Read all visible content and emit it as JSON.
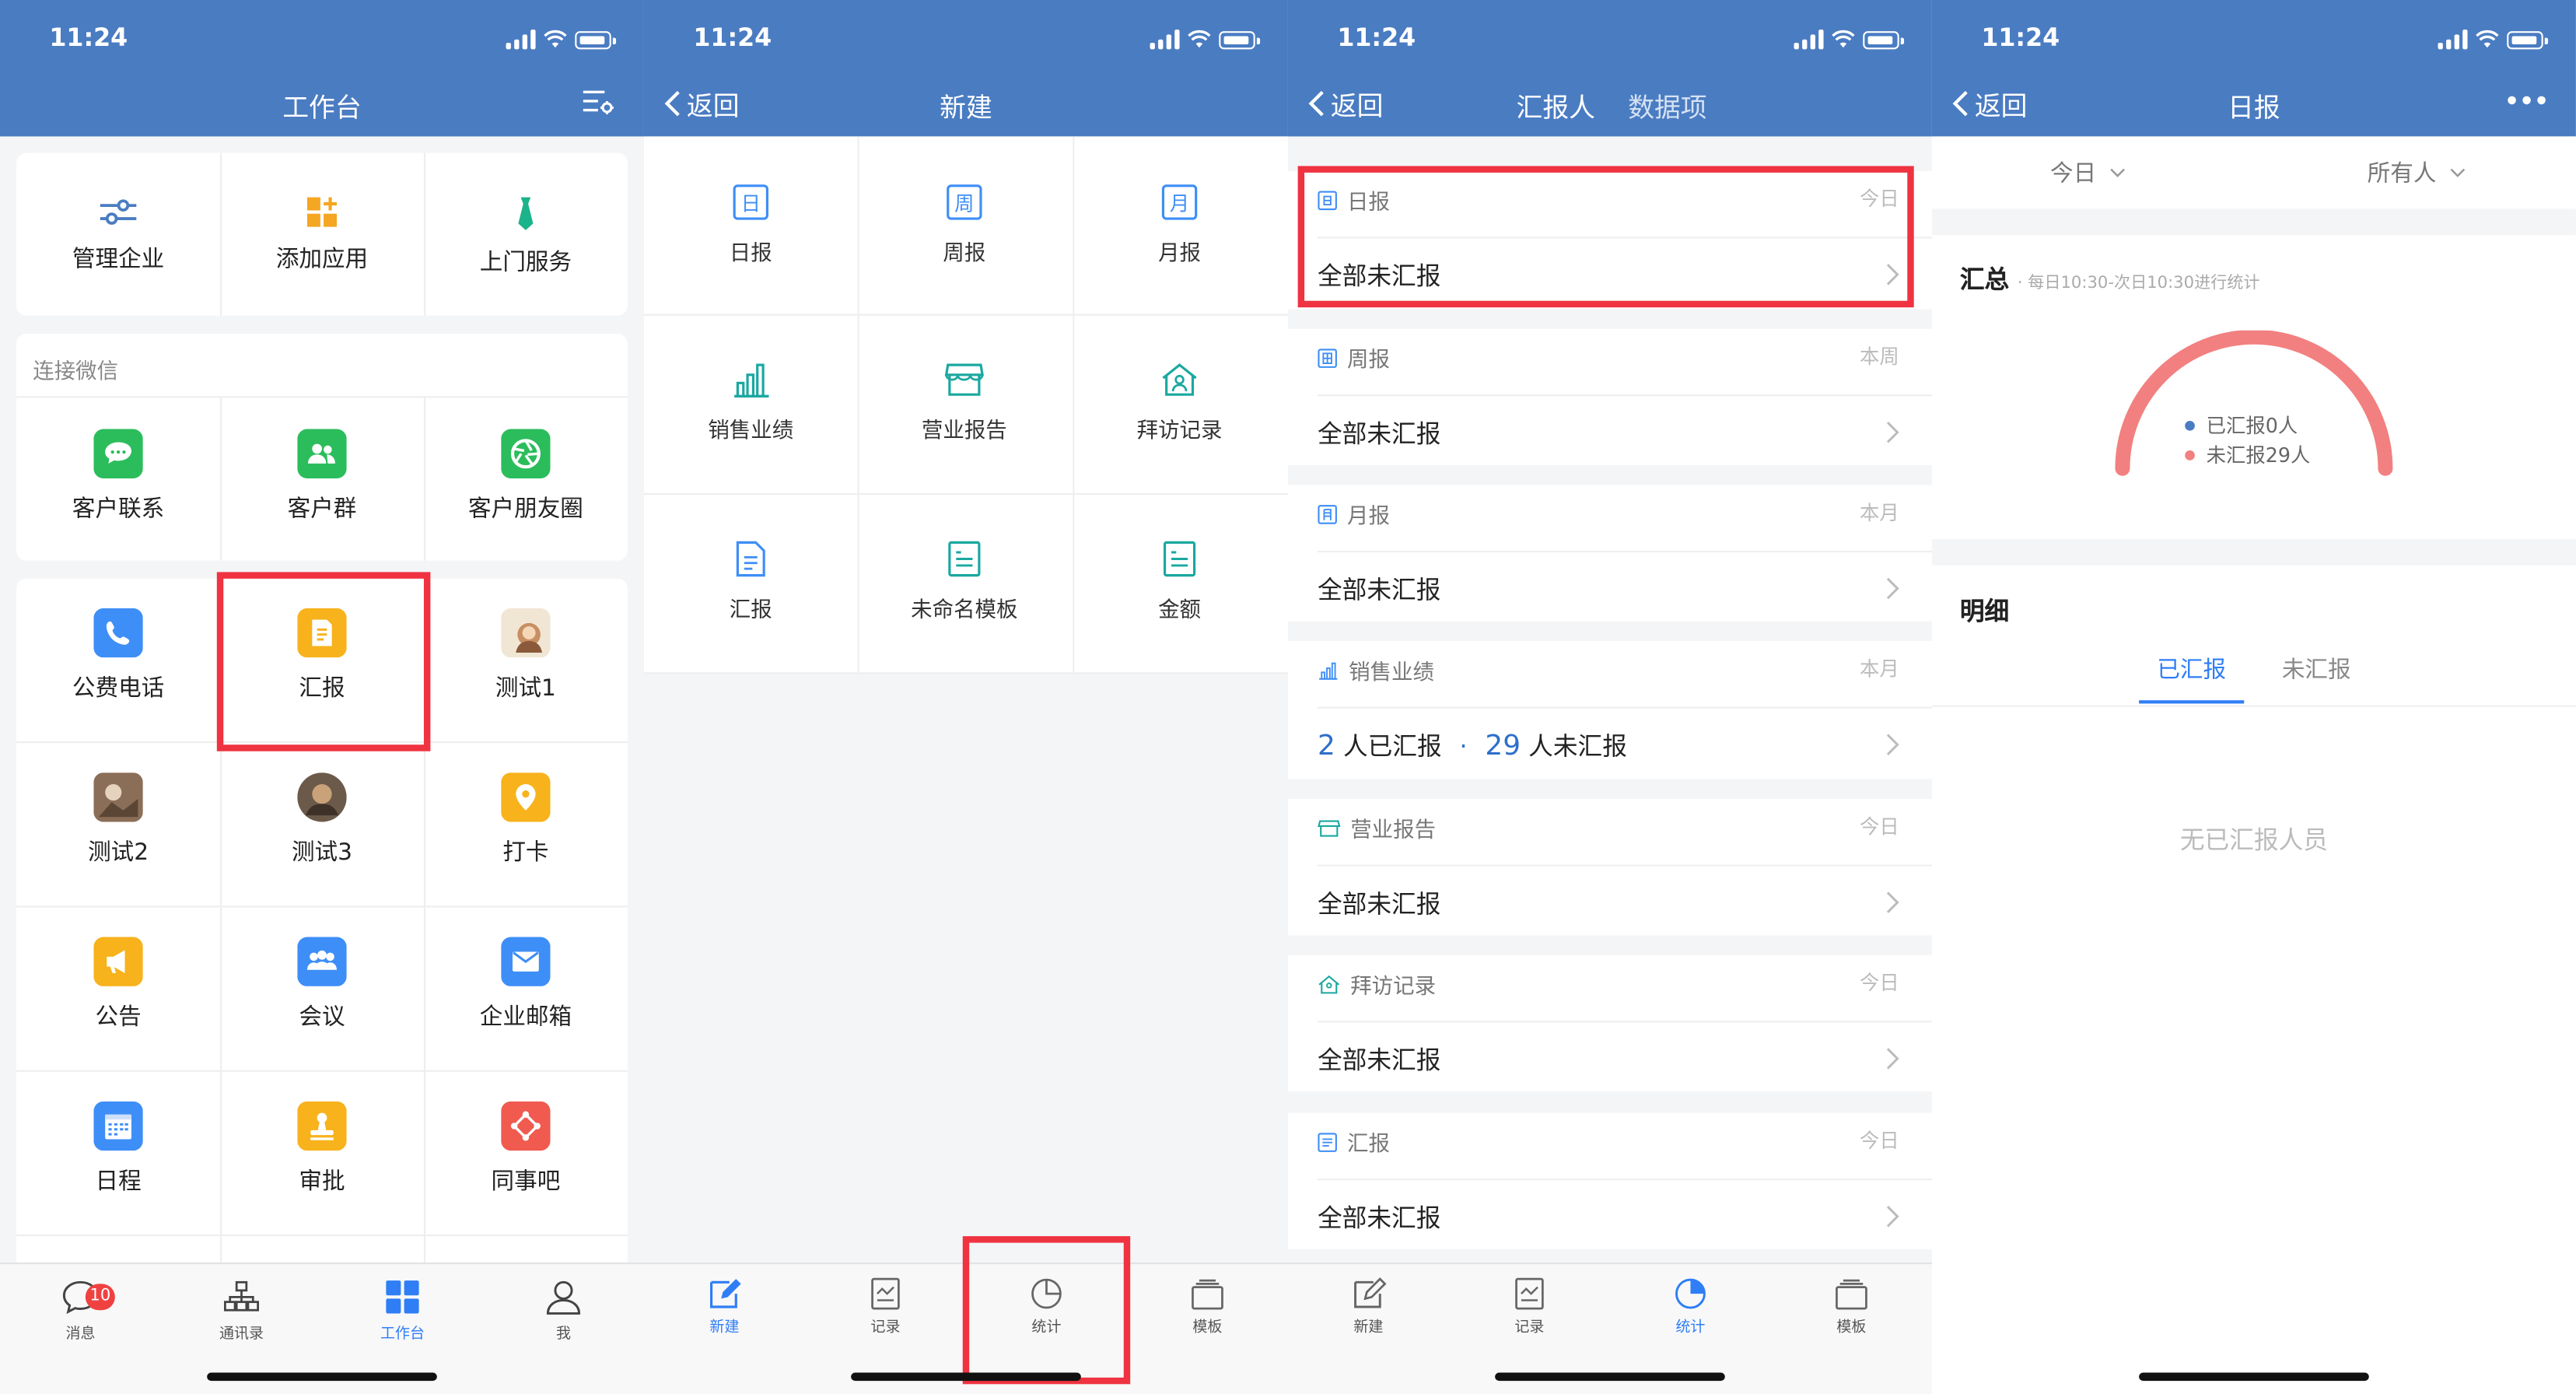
{
  "status": {
    "time": "11:24"
  },
  "screen1": {
    "title": "工作台",
    "top": [
      {
        "label": "管理企业"
      },
      {
        "label": "添加应用"
      },
      {
        "label": "上门服务"
      }
    ],
    "wechat_section": "连接微信",
    "wechat": [
      {
        "label": "客户联系"
      },
      {
        "label": "客户群"
      },
      {
        "label": "客户朋友圈"
      }
    ],
    "apps": [
      {
        "label": "公费电话"
      },
      {
        "label": "汇报"
      },
      {
        "label": "测试1"
      },
      {
        "label": "测试2"
      },
      {
        "label": "测试3"
      },
      {
        "label": "打卡"
      },
      {
        "label": "公告"
      },
      {
        "label": "会议"
      },
      {
        "label": "企业邮箱"
      },
      {
        "label": "日程"
      },
      {
        "label": "审批"
      },
      {
        "label": "同事吧"
      }
    ],
    "tabs": [
      {
        "label": "消息",
        "badge": "10"
      },
      {
        "label": "通讯录"
      },
      {
        "label": "工作台"
      },
      {
        "label": "我"
      }
    ]
  },
  "screen2": {
    "back": "返回",
    "title": "新建",
    "grid": [
      {
        "label": "日报",
        "glyph": "日"
      },
      {
        "label": "周报",
        "glyph": "周"
      },
      {
        "label": "月报",
        "glyph": "月"
      },
      {
        "label": "销售业绩"
      },
      {
        "label": "营业报告"
      },
      {
        "label": "拜访记录"
      },
      {
        "label": "汇报"
      },
      {
        "label": "未命名模板"
      },
      {
        "label": "金额"
      }
    ]
  },
  "report_tabs": [
    {
      "label": "新建"
    },
    {
      "label": "记录"
    },
    {
      "label": "统计"
    },
    {
      "label": "模板"
    }
  ],
  "screen3": {
    "back": "返回",
    "tab_active": "汇报人",
    "tab_other": "数据项",
    "groups": [
      {
        "name": "日报",
        "period": "今日",
        "summary": "全部未汇报"
      },
      {
        "name": "周报",
        "period": "本周",
        "summary": "全部未汇报"
      },
      {
        "name": "月报",
        "period": "本月",
        "summary": "全部未汇报"
      },
      {
        "name": "销售业绩",
        "period": "本月",
        "reported_num": "2",
        "reported_text": "人已汇报",
        "sep": "·",
        "unreported_num": "29",
        "unreported_text": "人未汇报"
      },
      {
        "name": "营业报告",
        "period": "今日",
        "summary": "全部未汇报"
      },
      {
        "name": "拜访记录",
        "period": "今日",
        "summary": "全部未汇报"
      },
      {
        "name": "汇报",
        "period": "今日",
        "summary": "全部未汇报"
      }
    ]
  },
  "screen4": {
    "back": "返回",
    "title": "日报",
    "filter_date": "今日",
    "filter_people": "所有人",
    "summary_title": "汇总",
    "summary_note": "每日10:30-次日10:30进行统计",
    "legend_reported": "已汇报0人",
    "legend_unreported": "未汇报29人",
    "chart_reported": 0,
    "chart_unreported": 29,
    "detail_title": "明细",
    "tab_reported": "已汇报",
    "tab_unreported": "未汇报",
    "empty": "无已汇报人员",
    "color_reported": "#4a7cc2",
    "color_unreported": "#f28080"
  },
  "colors": {
    "nav": "#4a7cc2",
    "active_tab": "#2f7ef6",
    "highlight": "#ef3340"
  }
}
